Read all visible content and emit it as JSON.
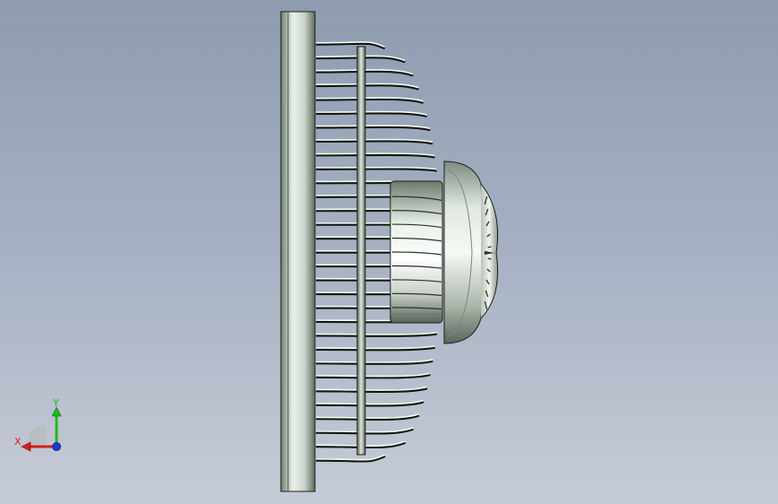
{
  "view": {
    "background_top": "#8e9bb0",
    "background_bottom": "#c6ccd7",
    "model": "fan-cage-side-view"
  },
  "triad": {
    "x_label": "X",
    "y_label": "Y",
    "x_color": "#d41e1e",
    "y_color": "#1fb81f",
    "z_color": "#1e3ad4"
  },
  "colors": {
    "metal_dark": "#5d6a5e",
    "metal_light": "#f3fbf2",
    "edge": "#1a1f1a"
  }
}
